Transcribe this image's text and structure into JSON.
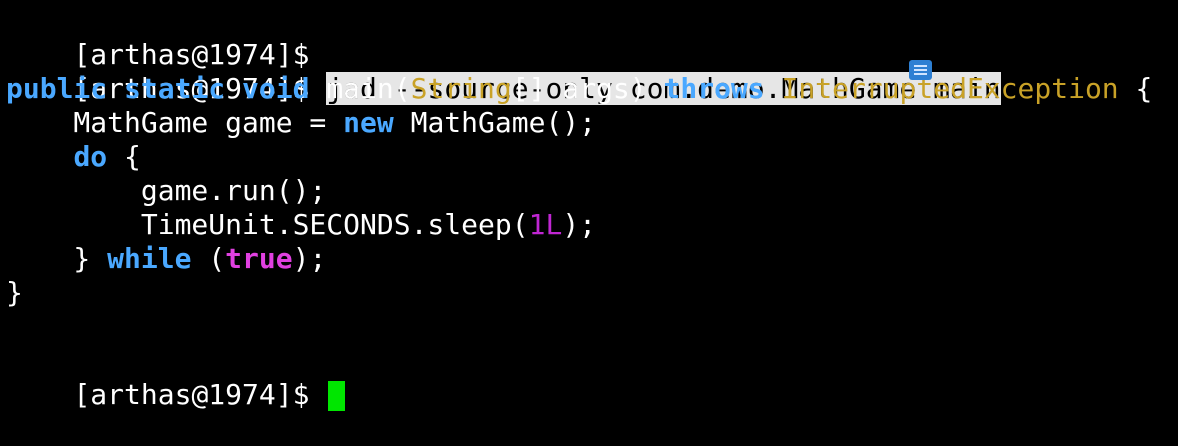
{
  "terminal": {
    "prompt": "[arthas@1974]$ ",
    "command": "jad --source-only com.demo.MathGame main",
    "code": {
      "l1_kw_public": "public",
      "l1_kw_static": "static",
      "l1_kw_void": "void",
      "l1_main": "main(",
      "l1_type_string": "String",
      "l1_args": "[] args) ",
      "l1_kw_throws": "throws",
      "l1_type_exc": "InterruptedException",
      "l1_brace": " {",
      "l2_pre": "    MathGame game = ",
      "l2_kw_new": "new",
      "l2_post": " MathGame();",
      "l3_indent": "    ",
      "l3_kw_do": "do",
      "l3_brace": " {",
      "l4": "        game.run();",
      "l5_pre": "        TimeUnit.SECONDS.sleep(",
      "l5_lit": "1L",
      "l5_post": ");",
      "l6_pre": "    } ",
      "l6_kw_while": "while",
      "l6_paren_open": " (",
      "l6_true": "true",
      "l6_paren_close": ");",
      "l7": "}"
    }
  },
  "colors": {
    "background": "#000000",
    "foreground": "#ffffff",
    "keyword": "#4aa8ff",
    "type": "#c9a227",
    "literal": "#c026d3",
    "cursor": "#00e600",
    "selection": "#e6e6e6"
  },
  "icons": {
    "overlay_badge": "document-icon"
  }
}
